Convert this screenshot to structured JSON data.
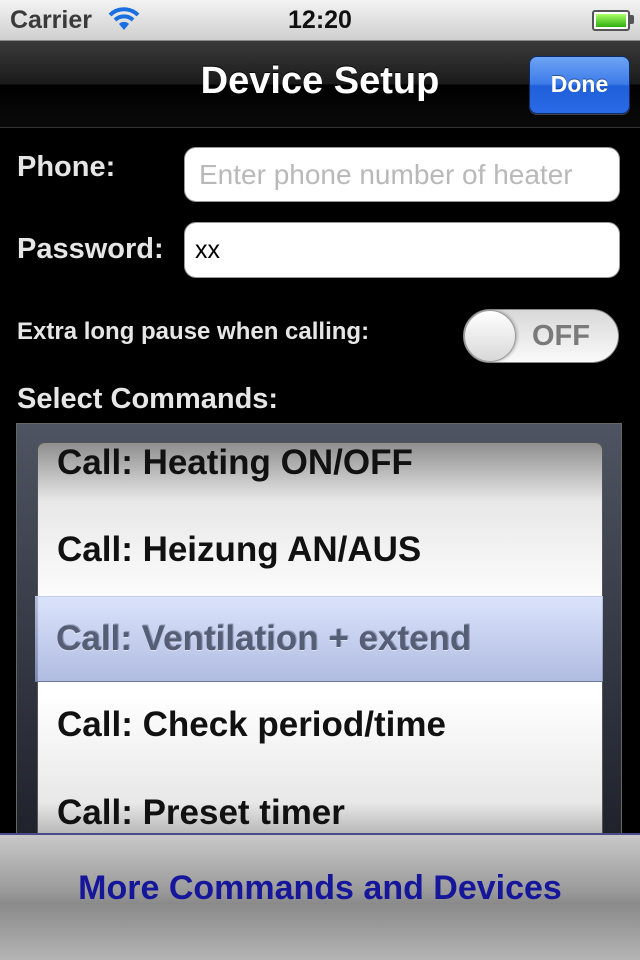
{
  "status_bar": {
    "carrier": "Carrier",
    "time": "12:20",
    "wifi_icon": "wifi-icon",
    "battery_icon": "battery-icon",
    "battery_level": 1.0
  },
  "nav": {
    "title": "Device Setup",
    "done_label": "Done",
    "accent_color": "#2a6ae6"
  },
  "form": {
    "phone_label": "Phone:",
    "phone_placeholder": "Enter phone number of heater",
    "phone_value": "",
    "password_label": "Password:",
    "password_value": "xx",
    "pause_label": "Extra long pause when calling:",
    "pause_toggle": {
      "state": "OFF"
    },
    "commands_label": "Select Commands:"
  },
  "picker": {
    "items": [
      "Call: Heating ON/OFF",
      "Call: Heizung AN/AUS",
      "Call: Ventilation + extend",
      "Call: Check period/time",
      "Call: Preset timer"
    ],
    "selected": "Call: Ventilation + extend"
  },
  "footer": {
    "more_label": "More Commands and Devices",
    "link_color": "#16169a"
  }
}
